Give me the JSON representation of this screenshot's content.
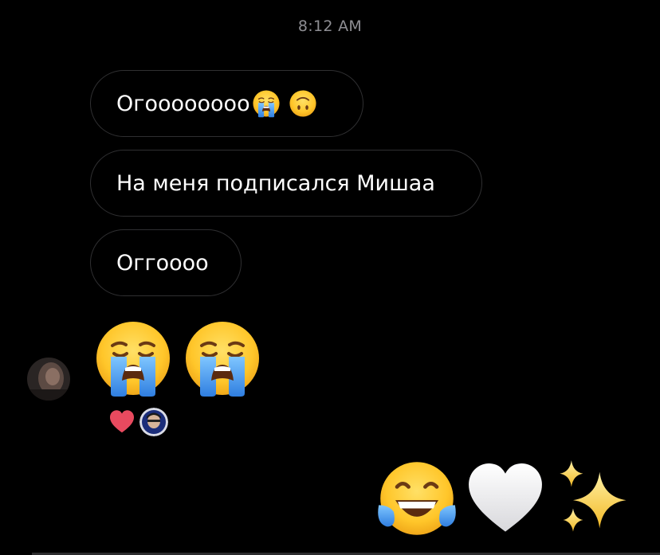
{
  "header": {
    "timestamp": "8:12 AM"
  },
  "messages": {
    "received": [
      {
        "text": "Огоооооооо",
        "emojis": [
          "loudly-crying-face",
          "upside-down-face"
        ]
      },
      {
        "text": "На меня подписался Мишаа"
      },
      {
        "text": "Оггоооо"
      }
    ],
    "received_emoji_message": [
      "loudly-crying-face",
      "loudly-crying-face"
    ],
    "reactions": [
      {
        "icon": "red-heart",
        "by": "user-avatar"
      }
    ],
    "sent_emoji_message": [
      "face-with-tears-of-joy",
      "white-heart",
      "sparkles"
    ]
  },
  "colors": {
    "background": "#000000",
    "bubble_border": "#2f2f31",
    "timestamp": "#8e8e93",
    "heart": "#e84a5f"
  }
}
